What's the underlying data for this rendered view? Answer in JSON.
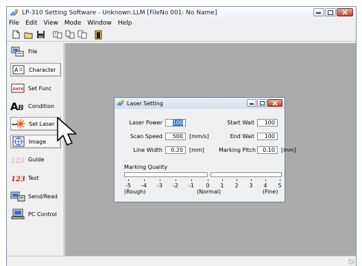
{
  "window": {
    "title": "LP-310 Setting Software - Unknown.LLM  [FileNo 001: No Name]"
  },
  "menu": [
    "File",
    "Edit",
    "View",
    "Mode",
    "Window",
    "Help"
  ],
  "toolbar": {
    "icons": [
      "new-file-icon",
      "open-folder-icon",
      "save-disk-icon",
      "send-icon",
      "transfer-icon",
      "copy-icon",
      "exit-door-icon"
    ]
  },
  "sidebar": {
    "items": [
      {
        "label": "File",
        "icon": "file-computer-icon"
      },
      {
        "label": "Character",
        "icon": "character-icon"
      },
      {
        "label": "Set Func",
        "icon": "date-icon",
        "icon_text": "DATE"
      },
      {
        "label": "Condition",
        "icon": "condition-icon",
        "icon_text": "AB"
      },
      {
        "label": "Set Laser",
        "icon": "laser-icon"
      },
      {
        "label": "Image",
        "icon": "image-icon"
      },
      {
        "label": "Guide",
        "icon": "guide-icon",
        "icon_text": "123"
      },
      {
        "label": "Test",
        "icon": "test-icon",
        "icon_text": "123"
      },
      {
        "label": "Send/Read",
        "icon": "send-read-icon"
      },
      {
        "label": "PC Control",
        "icon": "pc-control-icon"
      }
    ]
  },
  "dialog": {
    "title": "Laser Setting",
    "laser_power": {
      "label": "Laser Power",
      "value": "100"
    },
    "scan_speed": {
      "label": "Scan Speed",
      "value": "500",
      "unit": "[mm/s]"
    },
    "line_width": {
      "label": "Line Width",
      "value": "0.20",
      "unit": "[mm]"
    },
    "start_wait": {
      "label": "Start Wait",
      "value": "100"
    },
    "end_wait": {
      "label": "End Wait",
      "value": "100"
    },
    "marking_pitch": {
      "label": "Marking Pitch",
      "value": "0.10",
      "unit": "[mm]"
    },
    "marking_quality": {
      "label": "Marking Quality",
      "scale": [
        "-5",
        "-4",
        "-3",
        "-2",
        "-1",
        "0",
        "1",
        "2",
        "3",
        "4",
        "5"
      ],
      "rough": "(Rough)",
      "normal": "(Normal)",
      "fine": "(Fine)"
    }
  },
  "colors": {
    "workspace": "#ababab",
    "selection": "#3178c6",
    "close_button": "#c2452d"
  }
}
